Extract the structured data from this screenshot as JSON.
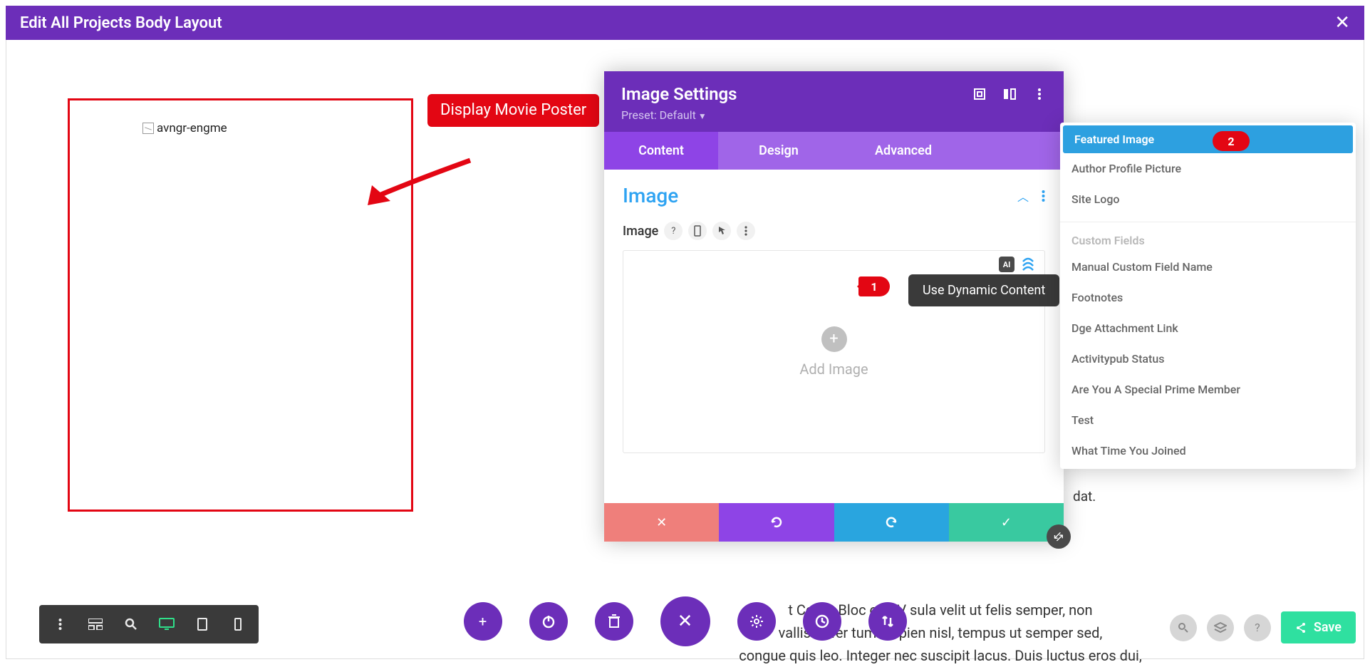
{
  "header": {
    "title": "Edit All Projects Body Layout"
  },
  "red_callout": "Display Movie Poster",
  "broken_image_alt": "avngr-engme",
  "panel": {
    "title": "Image Settings",
    "preset_label": "Preset: Default",
    "tabs": {
      "content": "Content",
      "design": "Design",
      "advanced": "Advanced"
    },
    "section_title": "Image",
    "field_label": "Image",
    "add_image_label": "Add Image",
    "dynamic_tooltip": "Use Dynamic Content"
  },
  "badges": {
    "one": "1",
    "two": "2"
  },
  "dropdown": {
    "items_top": [
      "Featured Image",
      "Author Profile Picture",
      "Site Logo"
    ],
    "custom_fields_header": "Custom Fields",
    "items_cf": [
      "Manual Custom Field Name",
      "Footnotes",
      "Dge Attachment Link",
      "Activitypub Status",
      "Are You A Special Prime Member",
      "Test",
      "What Time You Joined"
    ]
  },
  "background_text_1": "t Cont     t Bloc       ote. V      sula velit ut felis semper, non",
  "background_text_2": "vallis        or fer         tum.        sapien nisl, tempus ut semper sed,",
  "background_text_3": "congue quis leo. Integer nec suscipit lacus. Duis luctus eros dui,",
  "dat_fragment": "dat.",
  "save_label": "Save"
}
